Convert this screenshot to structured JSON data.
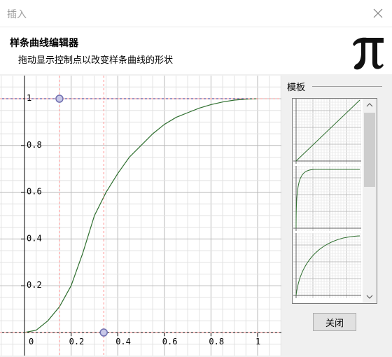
{
  "window": {
    "title": "插入"
  },
  "header": {
    "title": "样条曲线编辑器",
    "subtitle": "拖动显示控制点以改变样条曲线的形状"
  },
  "icons": {
    "logo": "pi-icon",
    "close": "close-icon"
  },
  "sidebar": {
    "label": "模板"
  },
  "buttons": {
    "close_label": "关闭"
  },
  "chart_data": {
    "type": "line",
    "xlim": [
      0,
      1
    ],
    "ylim": [
      0,
      1
    ],
    "x_ticks": [
      "0",
      "0.2",
      "0.4",
      "0.6",
      "0.8",
      "1"
    ],
    "y_ticks": [
      "0.2",
      "0.4",
      "0.6",
      "0.8",
      "1"
    ],
    "grid": true,
    "series": [
      {
        "x": [
          0,
          0.05,
          0.1,
          0.15,
          0.2,
          0.25,
          0.3,
          0.35,
          0.4,
          0.45,
          0.5,
          0.55,
          0.6,
          0.65,
          0.7,
          0.75,
          0.8,
          0.85,
          0.9,
          0.95,
          1.0
        ],
        "y": [
          0,
          0.01,
          0.05,
          0.11,
          0.2,
          0.34,
          0.5,
          0.6,
          0.68,
          0.75,
          0.8,
          0.85,
          0.89,
          0.92,
          0.94,
          0.96,
          0.975,
          0.986,
          0.994,
          0.998,
          1.0
        ]
      }
    ],
    "control_points": [
      {
        "x": 0.15,
        "y": 1.0
      },
      {
        "x": 0.34,
        "y": 0.0
      }
    ]
  },
  "templates": [
    {
      "name": "linear"
    },
    {
      "name": "ease-out-sharp"
    },
    {
      "name": "ease-out"
    }
  ],
  "colors": {
    "curve": "#2f6f2f",
    "control_point": "#8080c0",
    "grid": "#c8c8c8",
    "axis": "#000000"
  }
}
